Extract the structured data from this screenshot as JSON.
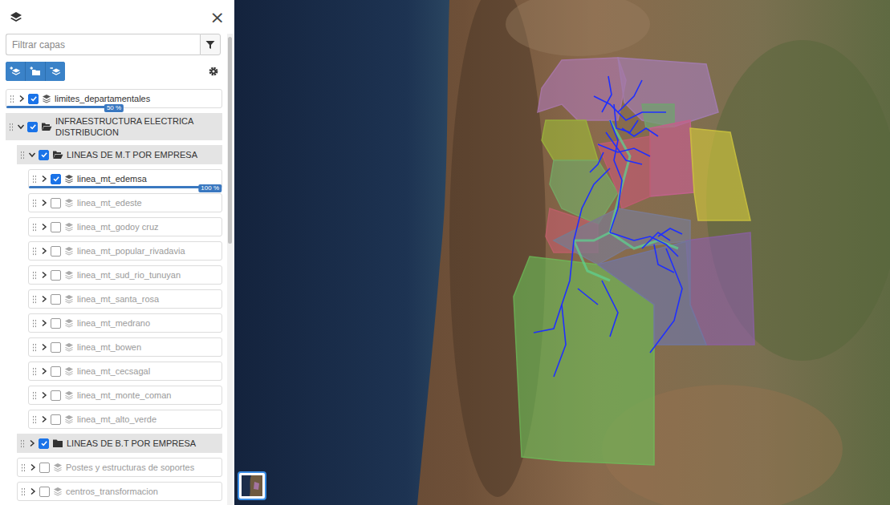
{
  "panel": {
    "close": "×",
    "filter_placeholder": "Filtrar capas"
  },
  "tree": [
    {
      "kind": "layer",
      "label": "limites_departamentales",
      "depth": 0,
      "checked": true,
      "expanded": false,
      "level": 0.5,
      "reading": "50 %"
    },
    {
      "kind": "group",
      "label": "INFRAESTRUCTURA ELECTRICA DISTRIBUCION",
      "depth": 0,
      "checked": true,
      "expanded": true
    },
    {
      "kind": "group",
      "label": "LINEAS DE M.T POR EMPRESA",
      "depth": 1,
      "checked": true,
      "expanded": true
    },
    {
      "kind": "layer",
      "label": "linea_mt_edemsa",
      "depth": 2,
      "checked": true,
      "expanded": false,
      "level": 1,
      "reading": "100 %"
    },
    {
      "kind": "layer",
      "label": "linea_mt_edeste",
      "depth": 2,
      "checked": false,
      "expanded": false
    },
    {
      "kind": "layer",
      "label": "linea_mt_godoy cruz",
      "depth": 2,
      "checked": false,
      "expanded": false
    },
    {
      "kind": "layer",
      "label": "linea_mt_popular_rivadavia",
      "depth": 2,
      "checked": false,
      "expanded": false
    },
    {
      "kind": "layer",
      "label": "linea_mt_sud_rio_tunuyan",
      "depth": 2,
      "checked": false,
      "expanded": false
    },
    {
      "kind": "layer",
      "label": "linea_mt_santa_rosa",
      "depth": 2,
      "checked": false,
      "expanded": false
    },
    {
      "kind": "layer",
      "label": "linea_mt_medrano",
      "depth": 2,
      "checked": false,
      "expanded": false
    },
    {
      "kind": "layer",
      "label": "linea_mt_bowen",
      "depth": 2,
      "checked": false,
      "expanded": false
    },
    {
      "kind": "layer",
      "label": "linea_mt_cecsagal",
      "depth": 2,
      "checked": false,
      "expanded": false
    },
    {
      "kind": "layer",
      "label": "linea_mt_monte_coman",
      "depth": 2,
      "checked": false,
      "expanded": false
    },
    {
      "kind": "layer",
      "label": "linea_mt_alto_verde",
      "depth": 2,
      "checked": false,
      "expanded": false
    },
    {
      "kind": "group",
      "label": "LINEAS DE B.T POR EMPRESA",
      "depth": 1,
      "checked": true,
      "expanded": false
    },
    {
      "kind": "layer",
      "label": "Postes y estructuras de soportes",
      "depth": 1,
      "checked": false,
      "expanded": false
    },
    {
      "kind": "layer",
      "label": "centros_transformacion",
      "depth": 1,
      "checked": false,
      "expanded": false
    }
  ],
  "map": {
    "departments": [
      {
        "color": "#b07ab8"
      },
      {
        "color": "#a97fc0"
      },
      {
        "color": "#6fae7a"
      },
      {
        "color": "#d0609a"
      },
      {
        "color": "#d9cf3c"
      },
      {
        "color": "#9fbe3a"
      },
      {
        "color": "#74b46a"
      },
      {
        "color": "#c95a78"
      },
      {
        "color": "#c75f6f"
      },
      {
        "color": "#7a7f9e"
      },
      {
        "color": "#8e5fae"
      },
      {
        "color": "#6cc25a"
      },
      {
        "color": "#6f78b0"
      }
    ]
  }
}
